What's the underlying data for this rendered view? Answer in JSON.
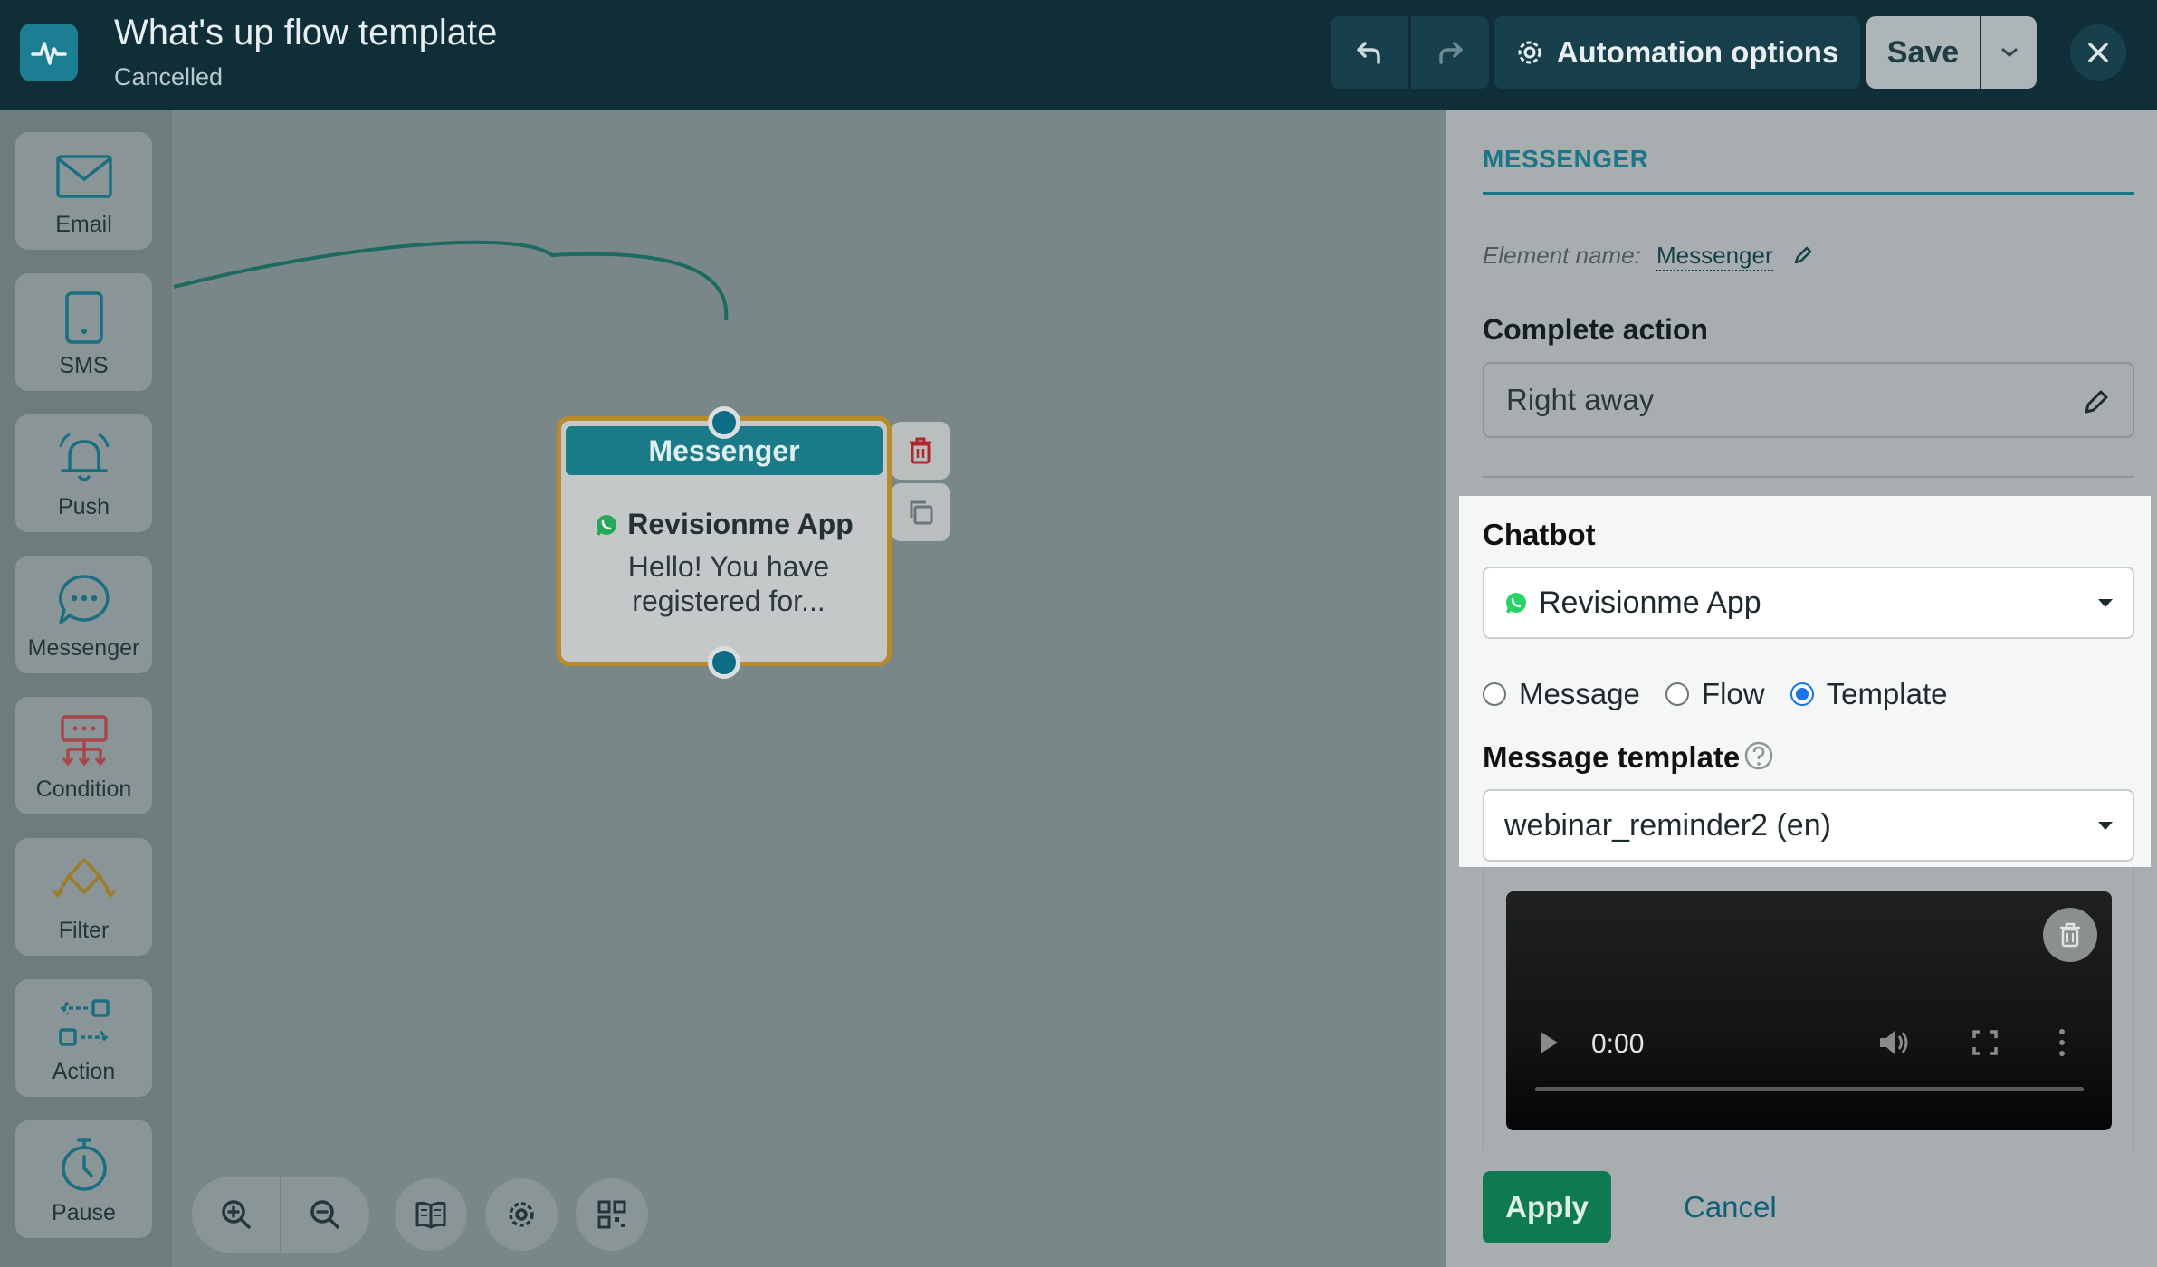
{
  "header": {
    "title": "What's up flow template",
    "status": "Cancelled",
    "automation_label": "Automation options",
    "save_label": "Save"
  },
  "palette": {
    "items": [
      {
        "label": "Email",
        "icon": "envelope-icon"
      },
      {
        "label": "SMS",
        "icon": "phone-icon"
      },
      {
        "label": "Push",
        "icon": "bell-icon"
      },
      {
        "label": "Messenger",
        "icon": "chat-bubble-icon"
      },
      {
        "label": "Condition",
        "icon": "condition-icon"
      },
      {
        "label": "Filter",
        "icon": "filter-icon"
      },
      {
        "label": "Action",
        "icon": "action-icon"
      },
      {
        "label": "Pause",
        "icon": "stopwatch-icon"
      }
    ]
  },
  "node": {
    "title": "Messenger",
    "bot": "Revisionme App",
    "text": "Hello! You have registered for..."
  },
  "panel": {
    "tab": "MESSENGER",
    "element_name_label": "Element name:",
    "element_name_value": "Messenger",
    "complete_action_label": "Complete action",
    "complete_action_value": "Right away",
    "chatbot_label": "Chatbot",
    "chatbot_value": "Revisionme App",
    "radio_message": "Message",
    "radio_flow": "Flow",
    "radio_template": "Template",
    "radio_selected": "Template",
    "template_label": "Message template",
    "template_value": "webinar_reminder2 (en)",
    "video_time": "0:00",
    "apply_label": "Apply",
    "cancel_label": "Cancel"
  },
  "colors": {
    "topbar": "#0f2e38",
    "accent": "#1b7688",
    "node_border": "#b98a2a",
    "apply": "#0f7a52",
    "whatsapp": "#25d366"
  }
}
